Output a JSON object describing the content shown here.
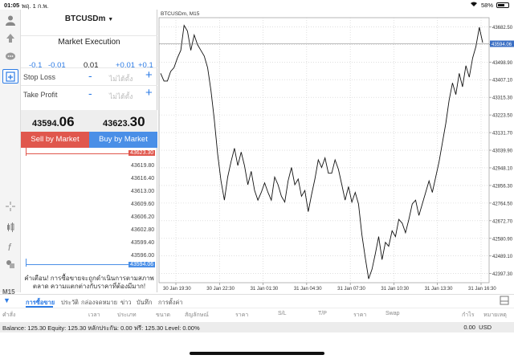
{
  "status": {
    "time": "01:05",
    "date": "พฤ. 1 ก.พ.",
    "battery": "58%",
    "battery_level": 0.58
  },
  "panel": {
    "symbol": "BTCUSDm",
    "execution": "Market Execution",
    "lots": [
      "-0.1",
      "-0.01",
      "0.01",
      "+0.01",
      "+0.1"
    ],
    "stop_loss": {
      "label": "Stop Loss",
      "placeholder": "ไม่ได้ตั้ง",
      "minus": "-",
      "plus": "+"
    },
    "take_profit": {
      "label": "Take Profit",
      "placeholder": "ไม่ได้ตั้ง",
      "minus": "-",
      "plus": "+"
    },
    "bid": {
      "main": "43594.",
      "big": "06"
    },
    "ask": {
      "main": "43623.",
      "big": "30"
    },
    "sell_label": "Sell by Market",
    "buy_label": "Buy by Market",
    "levels": [
      "43623.30",
      "43619.80",
      "43616.40",
      "43613.00",
      "43609.60",
      "43606.20",
      "43602.80",
      "43599.40",
      "43596.00",
      "43594.06"
    ],
    "warning": "คำเตือน! การซื้อขายจะถูกดำเนินการตามสภาพตลาด ความแตกต่างกับราคาที่ต้องมีมาก!"
  },
  "sidebar": {
    "timeframe": "M15"
  },
  "chart_data": {
    "type": "line",
    "title": "BTCUSDm, M15",
    "x_labels": [
      "30 Jan 19:30",
      "30 Jan 22:30",
      "31 Jan 01:30",
      "31 Jan 04:30",
      "31 Jan 07:30",
      "31 Jan 10:30",
      "31 Jan 13:30",
      "31 Jan 16:30"
    ],
    "y_ticks": [
      "43682.50",
      "43590.70",
      "43498.90",
      "43407.10",
      "43315.30",
      "43223.50",
      "43131.70",
      "43039.90",
      "42948.10",
      "42856.30",
      "42764.50",
      "42672.70",
      "42580.90",
      "42489.10",
      "42397.30"
    ],
    "current_price": "43594.06",
    "current_price_value": 43594.06,
    "ylim": [
      42350,
      43730
    ],
    "values": [
      43440,
      43400,
      43400,
      43450,
      43470,
      43520,
      43560,
      43690,
      43660,
      43560,
      43640,
      43590,
      43560,
      43530,
      43470,
      43350,
      43200,
      43020,
      42880,
      42780,
      42900,
      42980,
      43050,
      42960,
      43030,
      42960,
      42860,
      42930,
      42830,
      42780,
      42820,
      42870,
      42820,
      42780,
      42900,
      42860,
      42800,
      42770,
      42880,
      42950,
      42860,
      42890,
      42800,
      42830,
      42720,
      42810,
      42890,
      42990,
      42950,
      43000,
      42920,
      42920,
      42990,
      42940,
      42860,
      42780,
      42850,
      42770,
      42820,
      42760,
      42600,
      42480,
      42370,
      42420,
      42500,
      42590,
      42470,
      42560,
      42540,
      42620,
      42590,
      42680,
      42660,
      42610,
      42680,
      42760,
      42780,
      42700,
      42760,
      42820,
      42880,
      42820,
      42900,
      42980,
      43080,
      43180,
      43300,
      43390,
      43330,
      43440,
      43370,
      43480,
      43420,
      43520,
      43580,
      43680,
      43600
    ]
  },
  "tabs": [
    "การซื้อขาย",
    "ประวัติ",
    "กล่องจดหมาย",
    "ข่าว",
    "บันทึก",
    "การตั้งค่า"
  ],
  "columns": [
    "คำสั่ง",
    "เวลา",
    "ประเภท",
    "ขนาด",
    "สัญลักษณ์",
    "ราคา",
    "S/L",
    "T/P",
    "ราคา",
    "Swap",
    "กำไร",
    "หมายเหตุ"
  ],
  "balance": {
    "text": "Balance: 125.30 Equity: 125.30 หลักประกัน: 0.00 ฟรี: 125.30 Level: 0.00%",
    "profit": "0.00",
    "currency": "USD"
  }
}
